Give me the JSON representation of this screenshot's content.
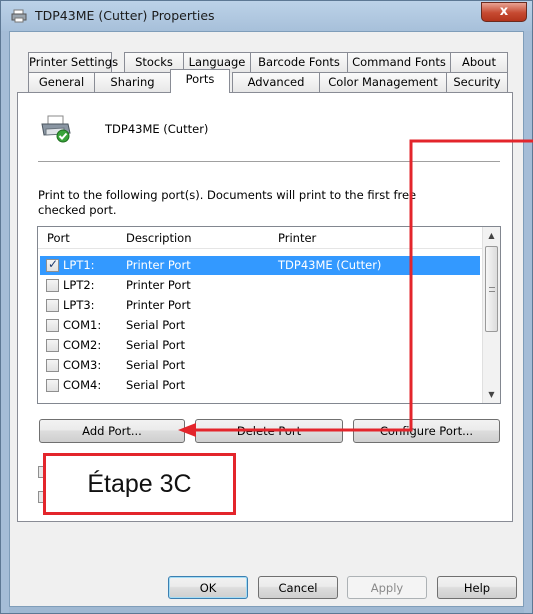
{
  "window": {
    "title": "TDP43ME (Cutter) Properties",
    "close_glyph": "x"
  },
  "tabs_row1": [
    "Printer Settings",
    "Stocks",
    "Language",
    "Barcode Fonts",
    "Command Fonts",
    "About"
  ],
  "tabs_row2": [
    "General",
    "Sharing",
    "Ports",
    "Advanced",
    "Color Management",
    "Security"
  ],
  "active_tab": "Ports",
  "printer": {
    "name": "TDP43ME (Cutter)",
    "icon": "printer-ok-icon"
  },
  "description": {
    "line1": "Print to the following port(s). Documents will print to the first free",
    "line2": "checked port."
  },
  "port_list": {
    "headers": {
      "port": "Port",
      "description": "Description",
      "printer": "Printer"
    },
    "rows": [
      {
        "port": "LPT1:",
        "description": "Printer Port",
        "printer": "TDP43ME (Cutter)",
        "checked": true,
        "selected": true
      },
      {
        "port": "LPT2:",
        "description": "Printer Port",
        "printer": "",
        "checked": false,
        "selected": false
      },
      {
        "port": "LPT3:",
        "description": "Printer Port",
        "printer": "",
        "checked": false,
        "selected": false
      },
      {
        "port": "COM1:",
        "description": "Serial Port",
        "printer": "",
        "checked": false,
        "selected": false
      },
      {
        "port": "COM2:",
        "description": "Serial Port",
        "printer": "",
        "checked": false,
        "selected": false
      },
      {
        "port": "COM3:",
        "description": "Serial Port",
        "printer": "",
        "checked": false,
        "selected": false
      },
      {
        "port": "COM4:",
        "description": "Serial Port",
        "printer": "",
        "checked": false,
        "selected": false
      }
    ]
  },
  "port_buttons": {
    "add": "Add Port...",
    "delete": "Delete Port",
    "configure": "Configure Port..."
  },
  "dialog_buttons": {
    "ok": "OK",
    "cancel": "Cancel",
    "apply": "Apply",
    "help": "Help"
  },
  "annotation": {
    "label": "Étape 3C",
    "color": "#e3252b"
  },
  "colors": {
    "selection": "#3399ff",
    "arrow": "#e3252b"
  }
}
